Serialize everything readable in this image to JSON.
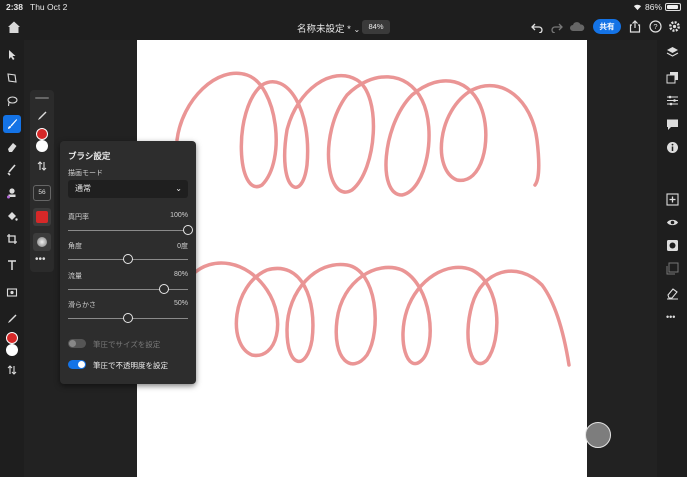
{
  "status": {
    "time": "2:38",
    "date": "Thu Oct 2",
    "battery": "86%"
  },
  "topbar": {
    "doc_title": "名称未設定 *",
    "zoom": "84%",
    "share_label": "共有"
  },
  "brush_panel": {
    "title": "ブラシ設定",
    "mode_label": "描画モード",
    "mode_value": "通常",
    "sliders": [
      {
        "label": "真円率",
        "value": "100%",
        "level": 1.0
      },
      {
        "label": "角度",
        "value": "0度",
        "level": 0.5
      },
      {
        "label": "流量",
        "value": "80%",
        "level": 0.8
      },
      {
        "label": "滑らかさ",
        "value": "50%",
        "level": 0.5
      }
    ],
    "toggles": [
      {
        "label": "筆圧でサイズを設定",
        "on": false
      },
      {
        "label": "筆圧で不透明度を設定",
        "on": true
      }
    ]
  },
  "strip": {
    "brush_size": "56"
  },
  "colors": {
    "accent": "#1473e6",
    "stroke": "#e88a8a",
    "fg_color": "#d62828"
  }
}
